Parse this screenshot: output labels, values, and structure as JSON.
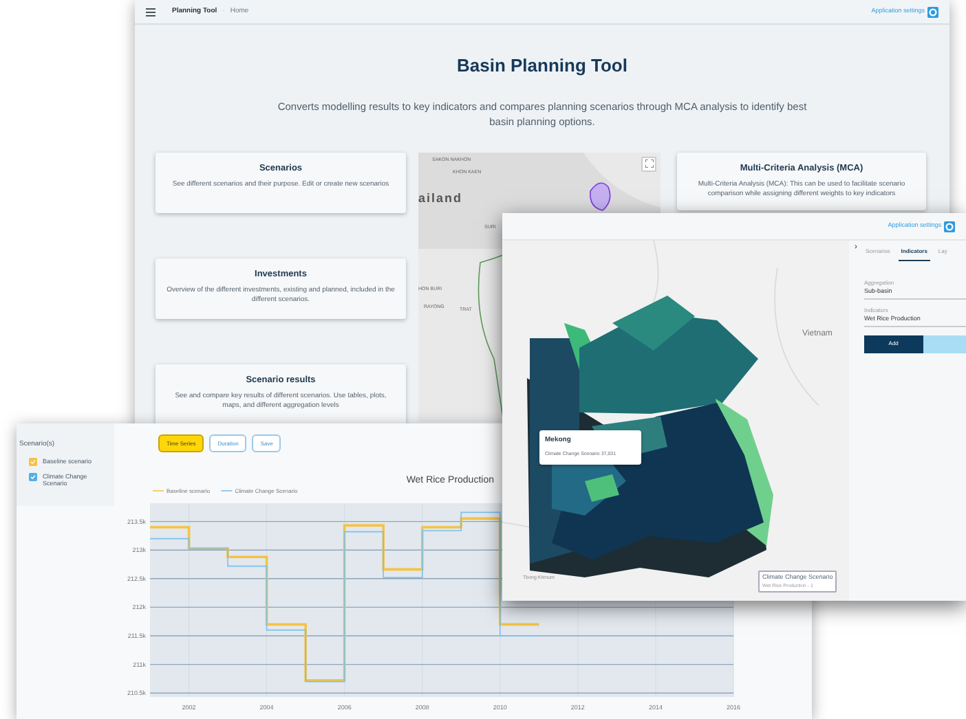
{
  "home_window": {
    "topbar": {
      "app_name": "Planning Tool",
      "separator": "·",
      "breadcrumb": "Home",
      "settings_label": "Application settings"
    },
    "title": "Basin Planning Tool",
    "description": "Converts modelling results to key indicators and compares planning scenarios through MCA analysis to identify best basin planning options.",
    "cards": [
      {
        "title": "Scenarios",
        "text": "See different scenarios and their purpose. Edit or create new scenarios"
      },
      {
        "title": "Investments",
        "text": "Overview of the different investments, existing and planned, included in the different scenarios."
      },
      {
        "title": "Scenario results",
        "text": "See and compare key results of different scenarios. Use tables, plots, maps, and different aggregation levels"
      },
      {
        "title": "Multi-Criteria Analysis (MCA)",
        "text": "Multi-Criteria Analysis (MCA): This can be used to facilitate scenario comparison while assigning different weights to key indicators"
      }
    ],
    "map_labels": [
      "SAKON NAKHON",
      "KHON KAEN",
      "ailand",
      "SURI",
      "HON BURI",
      "RAYONG",
      "TRAT"
    ]
  },
  "map_window": {
    "settings_label": "Application settings",
    "map_labels": [
      "Vietnam",
      "Tbong Khmum"
    ],
    "tooltip": {
      "title": "Mekong",
      "text": "Climate Change Scenario 37,031"
    },
    "legend": {
      "title": "Climate Change Scenario",
      "text": "Wet Rice Production - 1"
    },
    "panel": {
      "collapse": "›",
      "tabs": [
        {
          "label": "Scenarios",
          "selected": false
        },
        {
          "label": "Indicators",
          "selected": true
        },
        {
          "label": "Lay",
          "selected": false
        }
      ],
      "fields": [
        {
          "label": "Aggregation",
          "value": "Sub-basin"
        },
        {
          "label": "Indicators",
          "value": "Wet Rice Production"
        }
      ],
      "buttons": [
        {
          "label": "Add",
          "kind": "primary"
        },
        {
          "kind": "secondary"
        }
      ]
    }
  },
  "chart_window": {
    "sidebar": {
      "title": "Scenario(s)",
      "scenarios": [
        {
          "label": "Baseline scenario",
          "checked": true,
          "color": "#f5c342"
        },
        {
          "label": "Climate Change Scenario",
          "checked": true,
          "color": "#4fb0e8"
        }
      ]
    },
    "view_buttons": [
      {
        "label": "Time Series",
        "selected": true
      },
      {
        "label": "Duration",
        "selected": false
      },
      {
        "label": "Save",
        "selected": false
      }
    ],
    "chart_data": {
      "type": "line",
      "title": "Wet Rice Production",
      "grid": true,
      "legend": true,
      "x": [
        2001,
        2002,
        2002,
        2003,
        2003,
        2004,
        2004,
        2005,
        2005,
        2006,
        2006,
        2007,
        2007,
        2008,
        2008,
        2009,
        2009,
        2010,
        2010,
        2011
      ],
      "series": [
        {
          "name": "Baseline scenario",
          "color": "#f5c342",
          "values": [
            213.4,
            213.4,
            213.03,
            213.03,
            212.88,
            212.88,
            211.7,
            211.7,
            210.72,
            210.72,
            213.43,
            213.43,
            212.66,
            212.66,
            213.4,
            213.4,
            213.55,
            213.55,
            211.7,
            211.7
          ]
        },
        {
          "name": "Climate Change Scenario",
          "color": "#7cc0ec",
          "values": [
            213.2,
            213.2,
            213.02,
            213.02,
            212.72,
            212.72,
            211.6,
            211.6,
            210.7,
            210.7,
            213.32,
            213.32,
            212.52,
            212.52,
            213.34,
            213.34,
            213.66,
            213.66,
            211.5,
            211.5
          ]
        }
      ],
      "xlim": [
        2001,
        2016
      ],
      "ylim": [
        210.43,
        213.82
      ],
      "xticks": [
        2002,
        2004,
        2006,
        2008,
        2010,
        2012,
        2014,
        2016
      ],
      "yticks": [
        {
          "value": 213.5,
          "label": "213.5k"
        },
        {
          "value": 213,
          "label": "213k"
        },
        {
          "value": 212.5,
          "label": "212.5k"
        },
        {
          "value": 212,
          "label": "212k"
        },
        {
          "value": 211.5,
          "label": "211.5k"
        },
        {
          "value": 211,
          "label": "211k"
        },
        {
          "value": 210.5,
          "label": "210.5k"
        }
      ]
    }
  }
}
